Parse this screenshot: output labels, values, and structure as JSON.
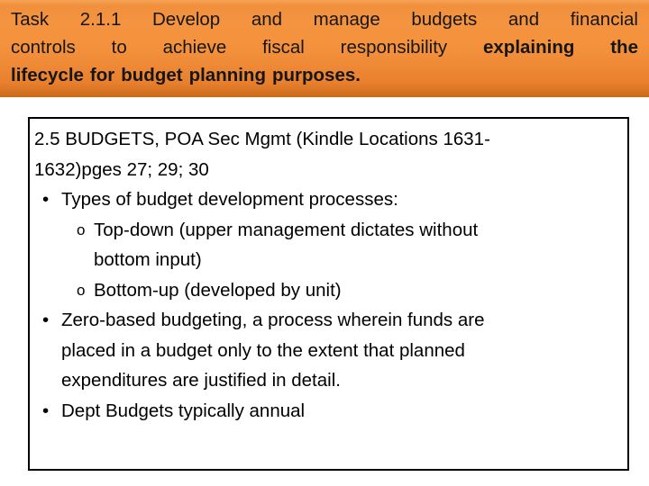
{
  "slide": {
    "title_banner": {
      "accent_color": "#ef9039",
      "accent_color_dark": "#c96a1c",
      "text_color": "#161616",
      "line1_words": [
        "Task",
        "2.1.1",
        "Develop",
        "and",
        "manage",
        "budgets",
        "and",
        "financial"
      ],
      "line2_words": [
        "controls",
        "to",
        "achieve",
        "fiscal",
        "responsibility"
      ],
      "line2_bold_words": [
        "explaining",
        "the"
      ],
      "line3_bold_words": [
        "lifecycle",
        "for",
        "budget",
        "planning",
        "purposes."
      ],
      "full_text": "Task 2.1.1 Develop and manage budgets and financial controls to achieve fiscal responsibility explaining the lifecycle for budget planning purposes."
    },
    "content_box": {
      "border_color": "#000000",
      "background_color": "#ffffff",
      "bullet_glyph": "•",
      "sub_bullet_glyph": "o",
      "lines": [
        {
          "level": 0,
          "text": "2.5 BUDGETS, POA Sec Mgmt (Kindle Locations 1631-"
        },
        {
          "level": 0,
          "text": "1632)pges 27; 29; 30"
        },
        {
          "level": 1,
          "bullet": true,
          "text": "Types of budget development processes:"
        },
        {
          "level": 2,
          "bullet": true,
          "text": "Top-down (upper management dictates without"
        },
        {
          "level": 2,
          "bullet": false,
          "text": "bottom input)"
        },
        {
          "level": 2,
          "bullet": true,
          "text": "Bottom-up (developed by unit)"
        },
        {
          "level": 1,
          "bullet": true,
          "text": "Zero-based budgeting, a process wherein funds are"
        },
        {
          "level": 1,
          "bullet": false,
          "text": "placed in a budget only to the extent that planned"
        },
        {
          "level": 1,
          "bullet": false,
          "text": "expenditures are justified in detail."
        },
        {
          "level": 1,
          "bullet": true,
          "text": "Dept Budgets typically annual"
        }
      ]
    }
  }
}
